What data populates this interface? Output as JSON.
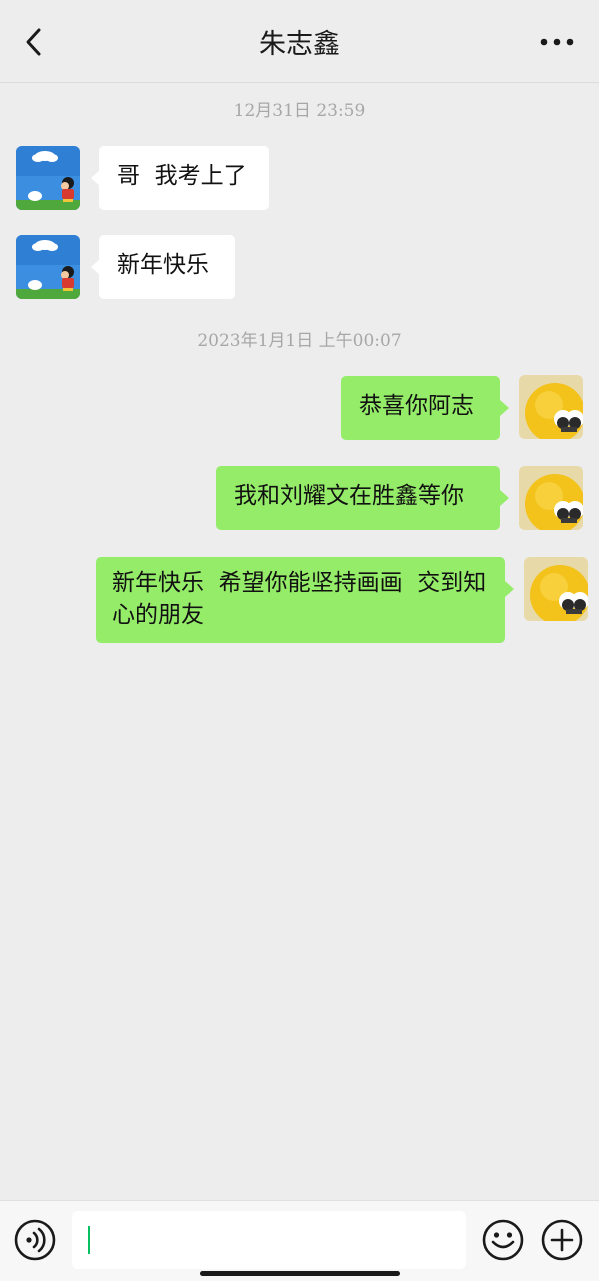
{
  "header": {
    "title": "朱志鑫",
    "back_icon": "chevron-left-icon",
    "more_icon": "more-horizontal-icon"
  },
  "timestamps": [
    "12月31日 23:59",
    "2023年1月1日 上午00:07"
  ],
  "messages": [
    {
      "side": "in",
      "text": "哥  我考上了"
    },
    {
      "side": "in",
      "text": "新年快乐"
    },
    {
      "side": "out",
      "text": "恭喜你阿志"
    },
    {
      "side": "out",
      "text": "我和刘耀文在胜鑫等你"
    },
    {
      "side": "out",
      "text": "新年快乐  希望你能坚持画画  交到知心的朋友"
    }
  ],
  "input_bar": {
    "voice_icon": "voice-icon",
    "input_value": "",
    "emoji_icon": "emoji-icon",
    "plus_icon": "plus-icon"
  },
  "colors": {
    "background": "#ededed",
    "outgoing_bubble": "#95ec69",
    "incoming_bubble": "#ffffff",
    "caret": "#07c160"
  }
}
